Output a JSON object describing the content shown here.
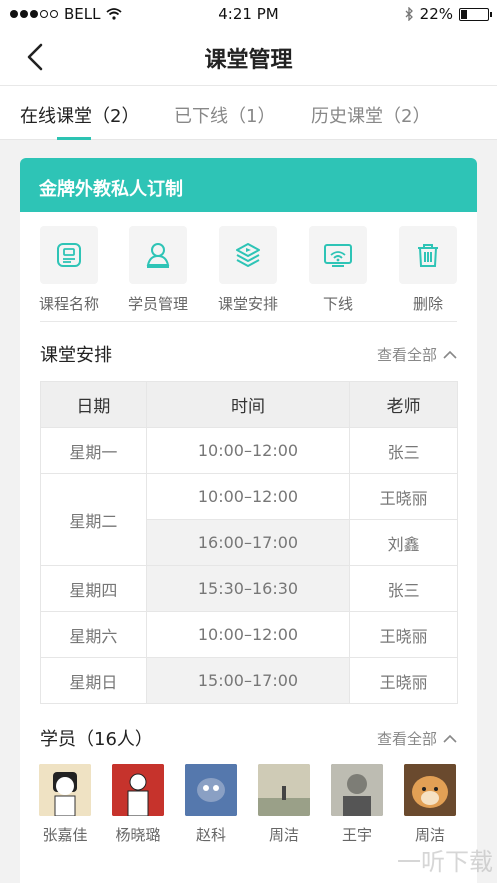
{
  "status_bar": {
    "carrier": "BELL",
    "time": "4:21 PM",
    "battery": "22%",
    "battery_level": 0.22
  },
  "nav": {
    "title": "课堂管理"
  },
  "tabs": [
    {
      "label": "在线课堂（2）"
    },
    {
      "label": "已下线（1）"
    },
    {
      "label": "历史课堂（2）"
    }
  ],
  "card": {
    "header": "金牌外教私人订制"
  },
  "actions": [
    {
      "label": "课程名称",
      "icon": "course-name-icon"
    },
    {
      "label": "学员管理",
      "icon": "student-management-icon"
    },
    {
      "label": "课堂安排",
      "icon": "class-schedule-icon"
    },
    {
      "label": "下线",
      "icon": "offline-icon"
    },
    {
      "label": "删除",
      "icon": "trash-icon"
    }
  ],
  "schedule": {
    "title": "课堂安排",
    "see_all": "查看全部",
    "headers": [
      "日期",
      "时间",
      "老师"
    ],
    "rows": [
      {
        "day": "星期一",
        "time": "10:00–12:00",
        "teacher": "张三"
      },
      {
        "day": "星期二",
        "time": "10:00–12:00",
        "teacher": "王晓丽"
      },
      {
        "day": "",
        "time": "16:00–17:00",
        "teacher": "刘鑫"
      },
      {
        "day": "星期四",
        "time": "15:30–16:30",
        "teacher": "张三"
      },
      {
        "day": "星期六",
        "time": "10:00–12:00",
        "teacher": "王晓丽"
      },
      {
        "day": "星期日",
        "time": "15:00–17:00",
        "teacher": "王晓丽"
      }
    ]
  },
  "students": {
    "title": "学员（16人）",
    "see_all": "查看全部",
    "list": [
      {
        "name": "张嘉佳",
        "avatar_color": "#e9d4a6"
      },
      {
        "name": "杨晓璐",
        "avatar_color": "#c6332c"
      },
      {
        "name": "赵科",
        "avatar_color": "#4a6ea8"
      },
      {
        "name": "周洁",
        "avatar_color": "#b9b6a2"
      },
      {
        "name": "王宇",
        "avatar_color": "#8e8e86"
      },
      {
        "name": "周洁",
        "avatar_color": "#d78a3a"
      }
    ]
  },
  "watermark": "一听下载"
}
